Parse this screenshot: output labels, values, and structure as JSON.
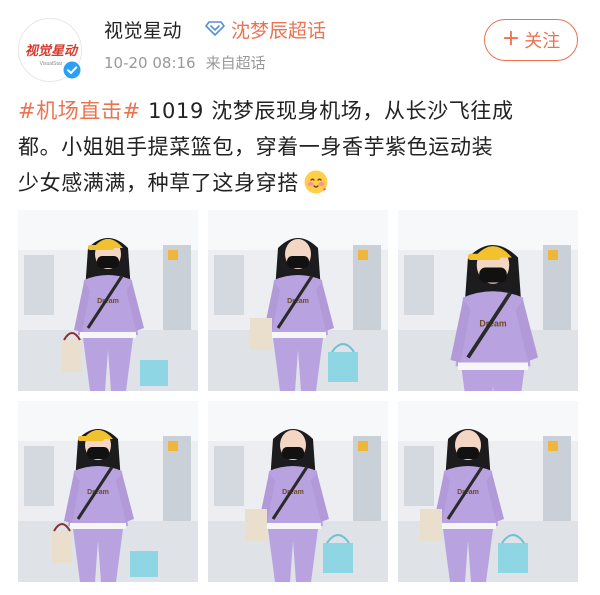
{
  "account": {
    "name": "视觉星动",
    "avatar_text": "视觉星动",
    "avatar_subtext": "VisualStar",
    "topic": "沈梦辰超话",
    "time": "10-20 08:16",
    "source": "来自超话"
  },
  "follow_button": {
    "label": "关注"
  },
  "post": {
    "hashtag": "#机场直击#",
    "line1_rest": " 1019 沈梦辰现身机场，从长沙飞往成",
    "line2": "都。小姐姐手提菜篮包，穿着一身香芋紫色运动装",
    "line3": "少女感满满，种草了这身穿搭"
  },
  "photos": [
    {
      "shirt_text": "Dream"
    },
    {
      "shirt_text": "Dream"
    },
    {
      "shirt_text": "Dream"
    },
    {
      "shirt_text": "Dream"
    },
    {
      "shirt_text": "Dream"
    },
    {
      "shirt_text": "Dream"
    }
  ],
  "colors": {
    "accent": "#eb7350",
    "lavender": "#b9a2e0",
    "cap_yellow": "#f2c12e",
    "bag_blue": "#8fd6e4"
  },
  "icons": [
    "verified-badge-icon",
    "super-topic-diamond-icon",
    "plus-icon",
    "blushing-emoji-icon"
  ]
}
